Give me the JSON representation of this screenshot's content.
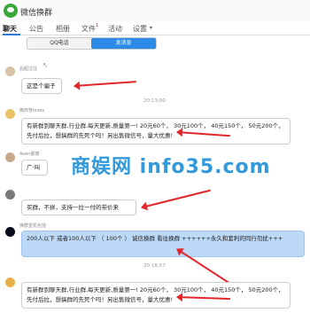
{
  "app": {
    "title": "微信换群"
  },
  "tabs": [
    {
      "label": "聊天"
    },
    {
      "label": "公告"
    },
    {
      "label": "相册"
    },
    {
      "label": "文件"
    },
    {
      "label": "活动"
    },
    {
      "label": "设置"
    }
  ],
  "file_badge": "1",
  "settings_chevron": "▾",
  "subtabs": [
    {
      "label": "QQ电话"
    },
    {
      "label": "发消息"
    }
  ],
  "messages": [
    {
      "name": "后起过往",
      "text": "这是个骗子"
    },
    {
      "time": "20:13:00"
    },
    {
      "name": "微商管loves",
      "text": "有新群到聊天群,行业群,每天更新,质量第一! 20元60个， 30元100个， 40元150个， 50元200个，先付后拉，想搞群的先死个吗！另出售微信号，量大优惠!"
    },
    {
      "name": "Aven翟丽",
      "text": "广·叫"
    },
    {
      "text": "买群，不拼，支持一拉一付的带价来"
    },
    {
      "name": "换群壹机包括",
      "text": "200人以下 或者100人以下 （ 100个 ） 诚信换群 看往换群 ++++++永久和套利的同行勿扰+++"
    },
    {
      "time": "20:18:57"
    },
    {
      "text": "有新群到聊天群,行业群,每天更新,质量第一! 20元60个， 30元100个， 40元150个， 50元200个，先付后拉，想搞群的先死个吗！另出售微信号，量大优惠!"
    }
  ],
  "watermark": "商娱网 info35.com",
  "colors": {
    "accent": "#2b7bd6",
    "arrow": "#e2262b",
    "highlight_bubble": "#bcd9f7"
  }
}
